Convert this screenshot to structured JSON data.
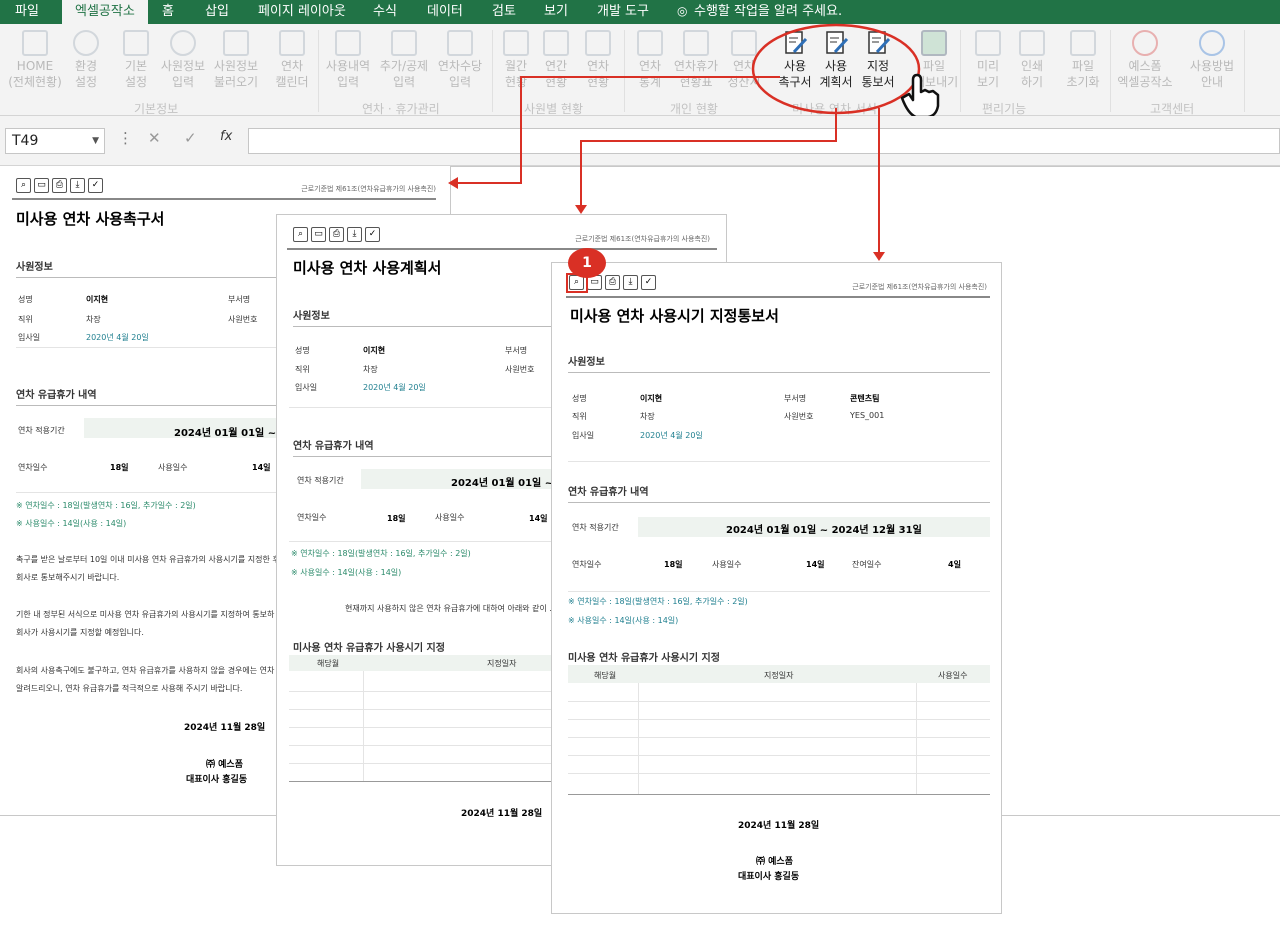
{
  "menu": [
    "파일",
    "엑셀공작소",
    "홈",
    "삽입",
    "페이지 레이아웃",
    "수식",
    "데이터",
    "검토",
    "보기",
    "개발 도구",
    "수행할 작업을 알려 주세요."
  ],
  "ribbon": {
    "buttons": [
      [
        "HOME",
        "(전체현황)"
      ],
      [
        "환경",
        "설정"
      ],
      [
        "기본",
        "설정"
      ],
      [
        "사원정보",
        "입력"
      ],
      [
        "사원정보",
        "불러오기"
      ],
      [
        "연차",
        "캘린더"
      ],
      [
        "사용내역",
        "입력"
      ],
      [
        "추가/공제",
        "입력"
      ],
      [
        "연차수당",
        "입력"
      ],
      [
        "월간",
        "현황"
      ],
      [
        "연간",
        "현황"
      ],
      [
        "연차",
        "현황"
      ],
      [
        "연차",
        "통계"
      ],
      [
        "연차휴가",
        "현황표"
      ],
      [
        "연차",
        "정산서"
      ],
      [
        "사용",
        "촉구서"
      ],
      [
        "사용",
        "계획서"
      ],
      [
        "지정",
        "통보서"
      ],
      [
        "파일",
        "내보내기"
      ],
      [
        "미리",
        "보기"
      ],
      [
        "인쇄",
        "하기"
      ],
      [
        "파일",
        "초기화"
      ],
      [
        "예스폼",
        "엑셀공작소"
      ],
      [
        "사용방법",
        "안내"
      ]
    ],
    "groups": [
      "기본정보",
      "연차 · 휴가관리",
      "사원별 현황",
      "개인 현황",
      "미사용 연차 서식",
      "편리기능",
      "고객센터"
    ]
  },
  "formula": {
    "cell_ref": "T49",
    "cancel": "✕",
    "enter": "✓",
    "fx": "fx"
  },
  "docs": {
    "law": "근로기준법 제61조(연차유급휴가의 사용촉진)",
    "titles": [
      "미사용 연차 사용촉구서",
      "미사용 연차 사용계획서",
      "미사용 연차 사용시기 지정통보서"
    ],
    "sec_emp": "사원정보",
    "lbl": {
      "name": "성명",
      "pos": "직위",
      "join": "입사일",
      "dept": "부서명",
      "empno": "사원번호"
    },
    "val": {
      "name": "이지현",
      "pos": "차장",
      "join": "2020년 4월 20일",
      "dept": "콘텐츠팀",
      "empno": "YES_001"
    },
    "sec_leave": "연차 유급휴가 내역",
    "period_lbl": "연차 적용기간",
    "period": "2024년 01월 01일 ~ 2024년 12월 31일",
    "period_short": "2024년 01월 01일 ~ 20",
    "stat": {
      "annual_lbl": "연차일수",
      "annual": "18일",
      "used_lbl": "사용일수",
      "used": "14일",
      "remain_lbl": "잔여일수",
      "remain": "4일"
    },
    "note1": "※ 연차일수 : 18일(발생연차 : 16일, 추가일수 : 2일)",
    "note2": "※ 사용일수 : 14일(사용 : 14일)",
    "body1": [
      "촉구를 받은 날로부터 10일 이내 미사용 연차 유급휴가의 사용시기를 지정한 후",
      "회사로 통보해주시기 바랍니다."
    ],
    "body2": [
      "기한 내 정부된 서식으로 미사용 연차 유급휴가의 사용시기를 지정하여 통보하",
      "회사가 사용시기를 지정할 예정입니다."
    ],
    "body3": [
      "회사의 사용촉구에도 불구하고, 연차 유급휴가를 사용하지 않을 경우에는 연차",
      "알려드리오니, 연차 유급휴가를 적극적으로 사용해 주시기 바랍니다."
    ],
    "plan_text": "현재까지 사용하지 않은 연차 유급휴가에 대하여 아래와 같이 ...",
    "sec_designate": "미사용 연차 유급휴가 사용시기 지정",
    "cols": {
      "c1": "해당월",
      "c2": "지정일자",
      "c3": "사용일수"
    },
    "date": "2024년 11월 28일",
    "company": "㈜ 예스폼",
    "ceo": "대표이사 홍길동"
  },
  "badge": "1"
}
